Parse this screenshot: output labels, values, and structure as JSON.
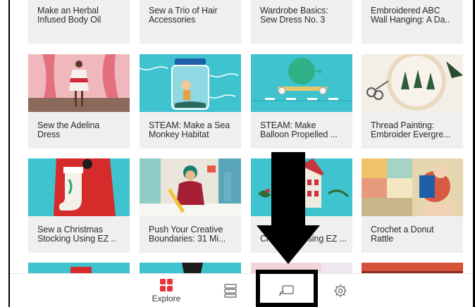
{
  "cards_row1": [
    {
      "title": "Make an Herbal\nInfused Body Oil"
    },
    {
      "title": "Sew a Trio of Hair\nAccessories"
    },
    {
      "title": "Wardrobe Basics:\nSew Dress No. 3"
    },
    {
      "title": "Embroidered ABC\nWall Hanging: A Da.."
    }
  ],
  "cards_row2": [
    {
      "title": "Sew the Adelina\nDress"
    },
    {
      "title": "STEAM: Make a Sea\nMonkey Habitat"
    },
    {
      "title": "STEAM: Make\nBalloon Propelled ..."
    },
    {
      "title": "Thread Painting:\nEmbroider Evergre..."
    }
  ],
  "cards_row3": [
    {
      "title": "Sew a Christmas\nStocking Using EZ .."
    },
    {
      "title": "Push Your Creative\nBoundaries: 31 Mi..."
    },
    {
      "title": "Cr\nChristmas Using EZ ..."
    },
    {
      "title": "Crochet a Donut\nRattle"
    }
  ],
  "tabbar": {
    "explore_label": "Explore",
    "explore_color": "#e8333a",
    "icons": [
      "explore-grid-icon",
      "library-icon",
      "screen-cast-icon",
      "settings-gear-icon"
    ]
  }
}
